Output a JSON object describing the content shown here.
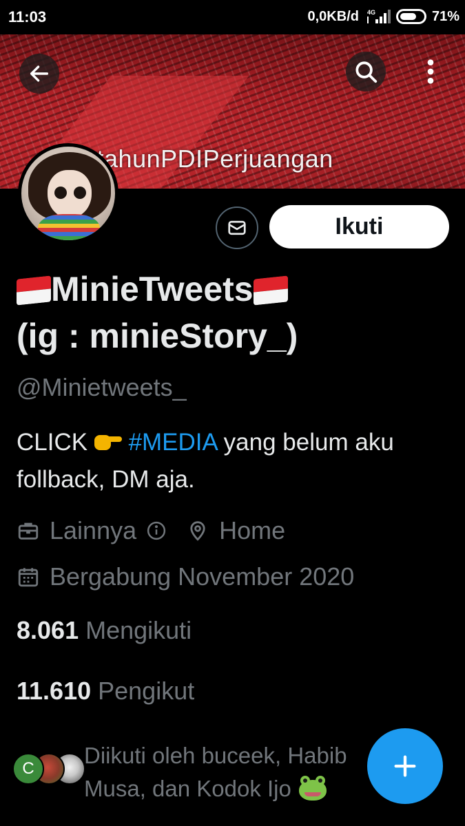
{
  "status_bar": {
    "time": "11:03",
    "speed": "0,0KB/d",
    "network": "4G",
    "battery": "71%",
    "battery_level": 0.71
  },
  "banner": {
    "text": "0tahunPDIPerjuangan"
  },
  "toolbar": {
    "back_icon": "arrow-left-icon",
    "search_icon": "search-icon",
    "more_icon": "more-vertical-icon"
  },
  "profile": {
    "name_line1": "MinieTweets",
    "name_line2": "(ig : minieStory_)",
    "handle": "@Minietweets_",
    "bio_prefix": "CLICK",
    "bio_hashtag": "#MEDIA",
    "bio_suffix": " yang belum aku follback, DM aja.",
    "category": "Lainnya",
    "location": "Home",
    "joined": "Bergabung November 2020"
  },
  "actions": {
    "message_icon": "envelope-icon",
    "follow_label": "Ikuti"
  },
  "stats": {
    "following_count": "8.061",
    "following_label": "Mengikuti",
    "followers_count": "11.610",
    "followers_label": "Pengikut"
  },
  "followed_by": {
    "avatar1_letter": "C",
    "text": "Diikuti oleh buceek, Habib Musa, dan Kodok Ijo"
  },
  "fab": {
    "icon": "plus-icon"
  },
  "colors": {
    "background": "#000000",
    "accent": "#1d9bf0",
    "text_primary": "#e7e9ea",
    "text_secondary": "#71767b",
    "follow_button_bg": "#ffffff"
  }
}
